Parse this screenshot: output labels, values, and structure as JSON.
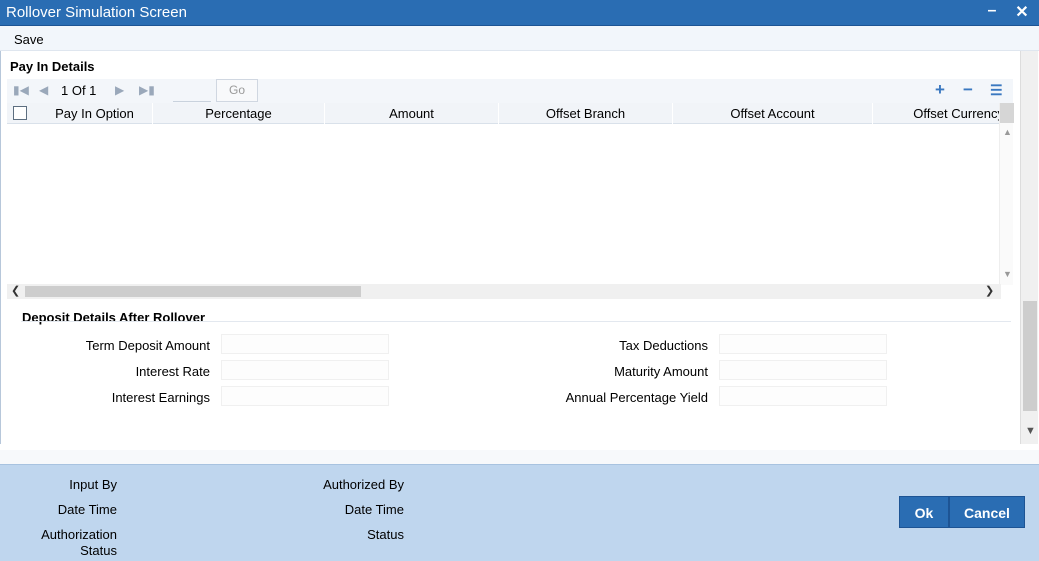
{
  "window": {
    "title": "Rollover Simulation Screen",
    "minimize": "–",
    "close": "✕"
  },
  "menu": {
    "save": "Save"
  },
  "pay_in": {
    "section_title": "Pay In Details",
    "pager": {
      "text": "1 Of 1",
      "go": "Go",
      "page_value": ""
    },
    "columns": [
      "Pay In Option",
      "Percentage",
      "Amount",
      "Offset Branch",
      "Offset Account",
      "Offset Currency"
    ]
  },
  "deposit": {
    "section_title": "Deposit Details After Rollover",
    "fields": {
      "term_deposit_amount": {
        "label": "Term Deposit Amount",
        "value": ""
      },
      "interest_rate": {
        "label": "Interest Rate",
        "value": ""
      },
      "interest_earnings": {
        "label": "Interest Earnings",
        "value": ""
      },
      "tax_deductions": {
        "label": "Tax Deductions",
        "value": ""
      },
      "maturity_amount": {
        "label": "Maturity Amount",
        "value": ""
      },
      "annual_percentage_yield": {
        "label": "Annual Percentage Yield",
        "value": ""
      }
    }
  },
  "audit": {
    "input_by": "Input By",
    "date_time_1": "Date Time",
    "authorization_status_1": "Authorization",
    "authorization_status_2": "Status",
    "authorized_by": "Authorized By",
    "date_time_2": "Date Time",
    "status": "Status"
  },
  "buttons": {
    "ok": "Ok",
    "cancel": "Cancel"
  },
  "icons": {
    "first": "first-page-icon",
    "prev": "prev-page-icon",
    "next": "next-page-icon",
    "last": "last-page-icon",
    "add": "add-row-icon",
    "delete": "delete-row-icon",
    "view": "single-view-icon"
  },
  "colors": {
    "title_bar": "#2a6db3",
    "footer_panel": "#bfd6ee",
    "button": "#2a6db3"
  }
}
